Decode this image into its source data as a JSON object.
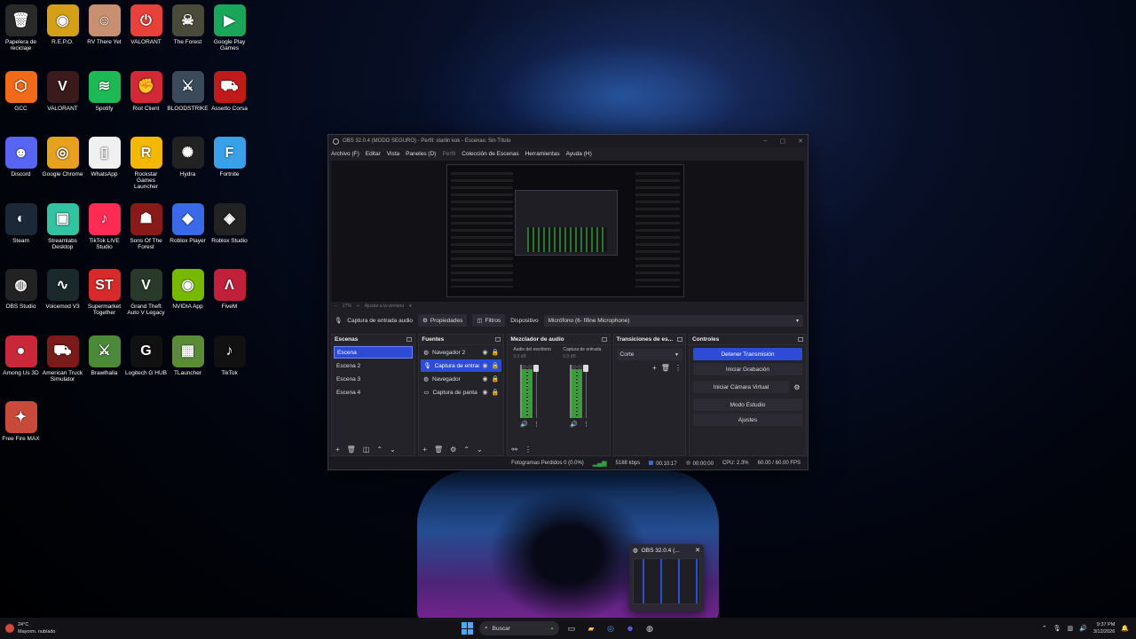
{
  "desktop": {
    "icons": [
      {
        "label": "Papelera de reciclaje",
        "glyph": "🗑",
        "color": "#2a2a2a"
      },
      {
        "label": "R.E.P.O.",
        "glyph": "◉",
        "color": "#d4a017"
      },
      {
        "label": "RV There Yet",
        "glyph": "☺",
        "color": "#c89070"
      },
      {
        "label": "VALORANT",
        "glyph": "⏻",
        "color": "#e8413a"
      },
      {
        "label": "The Forest",
        "glyph": "☠",
        "color": "#4a4a3a"
      },
      {
        "label": "Google Play Games",
        "glyph": "▶",
        "color": "#1aa55a"
      },
      {
        "label": "GCC",
        "glyph": "⬡",
        "color": "#f06a1a"
      },
      {
        "label": "VALORANT",
        "glyph": "V",
        "color": "#3a1a1a"
      },
      {
        "label": "Spotify",
        "glyph": "≋",
        "color": "#1db954"
      },
      {
        "label": "Riot Client",
        "glyph": "✊",
        "color": "#d32936"
      },
      {
        "label": "BLOODSTRIKE",
        "glyph": "⚔",
        "color": "#3a4a5a"
      },
      {
        "label": "Assetto Corsa",
        "glyph": "⛟",
        "color": "#c01a1a"
      },
      {
        "label": "Discord",
        "glyph": "☻",
        "color": "#5865f2"
      },
      {
        "label": "Google Chrome",
        "glyph": "◎",
        "color": "#e8a020"
      },
      {
        "label": "WhatsApp",
        "glyph": "▯",
        "color": "#f0f0f0"
      },
      {
        "label": "Rockstar Games Launcher",
        "glyph": "R",
        "color": "#f5b800"
      },
      {
        "label": "Hydra",
        "glyph": "✺",
        "color": "#222"
      },
      {
        "label": "Fortnite",
        "glyph": "F",
        "color": "#3aa0e8"
      },
      {
        "label": "Steam",
        "glyph": "◐",
        "color": "#1b2838"
      },
      {
        "label": "Streamlabs Desktop",
        "glyph": "▣",
        "color": "#31c3a2"
      },
      {
        "label": "TikTok LIVE Studio",
        "glyph": "♪",
        "color": "#fe2c55"
      },
      {
        "label": "Sons Of The Forest",
        "glyph": "☗",
        "color": "#8a1a1a"
      },
      {
        "label": "Roblox Player",
        "glyph": "◆",
        "color": "#3a6ae8"
      },
      {
        "label": "Roblox Studio",
        "glyph": "◈",
        "color": "#222"
      },
      {
        "label": "OBS Studio",
        "glyph": "◍",
        "color": "#222"
      },
      {
        "label": "Voicemod V3",
        "glyph": "∿",
        "color": "#1a2a2a"
      },
      {
        "label": "Supermarket Together",
        "glyph": "ST",
        "color": "#d82a2a"
      },
      {
        "label": "Grand Theft Auto V Legacy",
        "glyph": "V",
        "color": "#2a3a2a"
      },
      {
        "label": "NVIDIA App",
        "glyph": "◉",
        "color": "#76b900"
      },
      {
        "label": "FiveM",
        "glyph": "Λ",
        "color": "#c0203a"
      },
      {
        "label": "Among Us 3D",
        "glyph": "●",
        "color": "#c8283a"
      },
      {
        "label": "American Truck Simulator",
        "glyph": "⛟",
        "color": "#7a1a1a"
      },
      {
        "label": "Brawlhalla",
        "glyph": "⚔",
        "color": "#4a8a3a"
      },
      {
        "label": "Logitech G HUB",
        "glyph": "G",
        "color": "#111"
      },
      {
        "label": "TLauncher",
        "glyph": "▦",
        "color": "#5a8a3a"
      },
      {
        "label": "TikTok",
        "glyph": "♪",
        "color": "#111"
      },
      {
        "label": "Free Fire MAX",
        "glyph": "✦",
        "color": "#c84a3a"
      }
    ]
  },
  "obs": {
    "title": "OBS 32.0.4 (MODO SEGURO) - Perfil: starlin kok - Escenas: Sin Título",
    "menu": [
      "Archivo (F)",
      "Editar",
      "Vista",
      "Paneles (D)",
      "Perfil",
      "Colección de Escenas",
      "Herramientas",
      "Ayuda (H)"
    ],
    "preview_footer": {
      "zoom": "27%",
      "fit": "Ajustar a la ventana"
    },
    "source_toolbar": {
      "source_name": "Captura de entrada audio",
      "properties": "Propiedades",
      "filters": "Filtros",
      "device_label": "Dispositivo",
      "device_value": "Micrófono (6- fifine Microphone)"
    },
    "scenes": {
      "title": "Escenas",
      "items": [
        "Escena",
        "Escena 2",
        "Escena 3",
        "Escena 4"
      ]
    },
    "sources": {
      "title": "Fuentes",
      "items": [
        "Navegador 2",
        "Captura de entrada",
        "Navegador",
        "Captura de panta"
      ]
    },
    "mixer": {
      "title": "Mezclador de audio",
      "channels": [
        {
          "name": "Audio del escritorio",
          "db": "0.0 dB"
        },
        {
          "name": "Captura de entrada",
          "db": "0.0 dB"
        }
      ]
    },
    "transitions": {
      "title": "Transiciones de es...",
      "selected": "Corte"
    },
    "controls": {
      "title": "Controles",
      "stop_stream": "Detener Transmisión",
      "start_recording": "Iniciar Grabación",
      "virtual_camera": "Iniciar Cámara Virtual",
      "studio_mode": "Modo Estudio",
      "settings": "Ajustes"
    },
    "status": {
      "dropped_frames": "Fotogramas Perdidos 0 (0.0%)",
      "bitrate": "5188 kbps",
      "stream_time": "00:10:17",
      "rec_time": "00:00:00",
      "cpu": "CPU: 2.3%",
      "fps": "60.00 / 60.00 FPS"
    }
  },
  "thumbnail": {
    "title": "OBS 32.0.4 (..."
  },
  "taskbar": {
    "weather_temp": "24°C",
    "weather_desc": "Mayorm. nublado",
    "search_placeholder": "Buscar",
    "time": "9:37 PM",
    "date": "3/12/2026"
  }
}
